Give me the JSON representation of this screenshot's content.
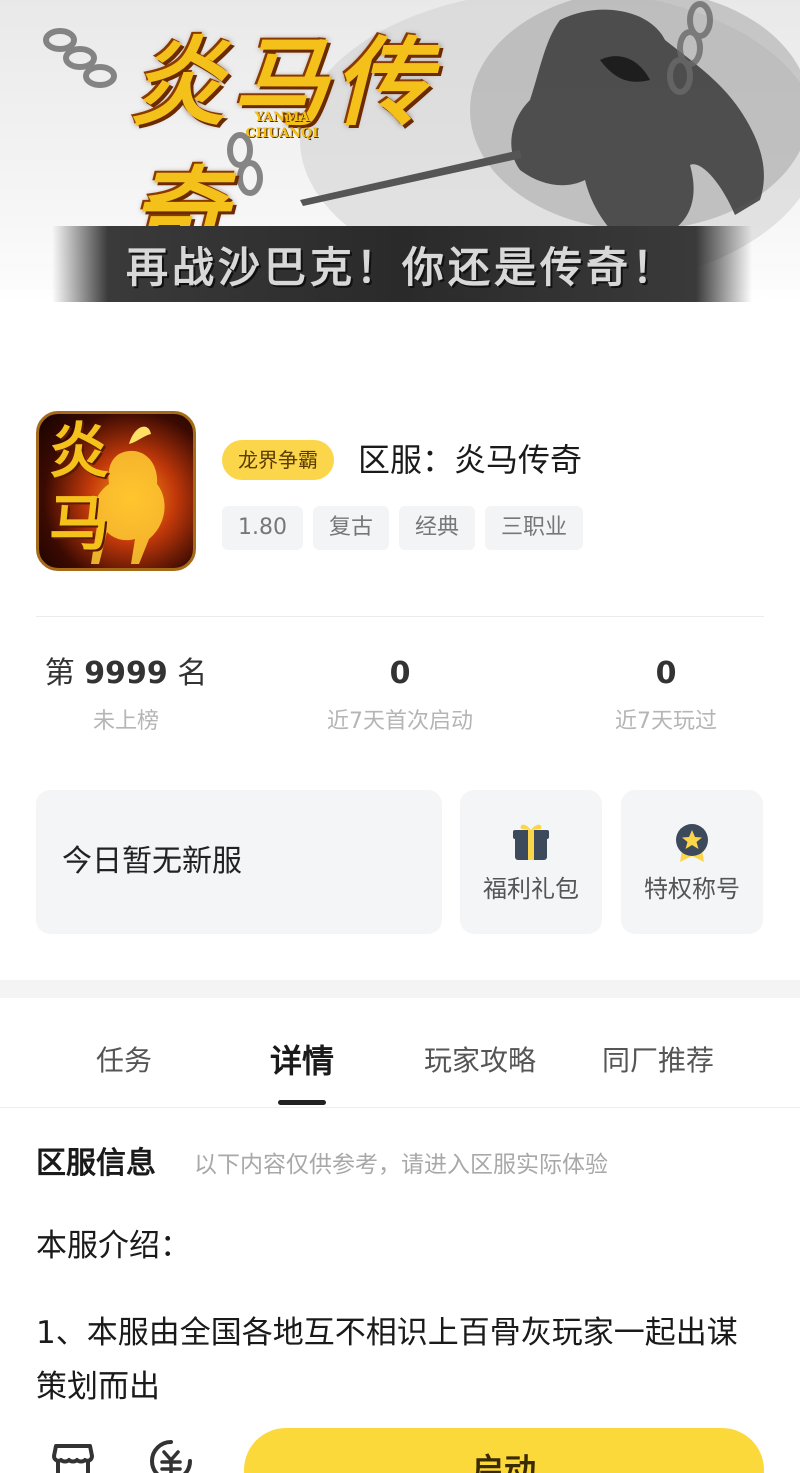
{
  "banner": {
    "logo_cn": "炎马传奇",
    "logo_en_line1": "YANMA",
    "logo_en_line2": "CHUANQI",
    "slogan": "再战沙巴克！你还是传奇！"
  },
  "game": {
    "icon_text": "炎马",
    "tag": "龙界争霸",
    "title": "区服：炎马传奇",
    "chips": [
      "1.80",
      "复古",
      "经典",
      "三职业"
    ]
  },
  "stats": {
    "rank_prefix": "第 ",
    "rank_value": "9999",
    "rank_suffix": " 名",
    "rank_label": "未上榜",
    "first_launch_value": "0",
    "first_launch_label": "近7天首次启动",
    "played_value": "0",
    "played_label": "近7天玩过"
  },
  "cards": {
    "new_server": "今日暂无新服",
    "gift_label": "福利礼包",
    "title_label": "特权称号"
  },
  "tabs": [
    {
      "label": "任务",
      "active": false
    },
    {
      "label": "详情",
      "active": true
    },
    {
      "label": "玩家攻略",
      "active": false
    },
    {
      "label": "同厂推荐",
      "active": false
    }
  ],
  "content": {
    "heading": "区服信息",
    "note": "以下内容仅供参考，请进入区服实际体验",
    "intro_title": "本服介绍：",
    "intro_body": "1、本服由全国各地互不相识上百骨灰玩家一起出谋策划而出"
  },
  "bottom": {
    "launch_label": "启动"
  },
  "colors": {
    "accent_yellow": "#fcd93a",
    "tag_yellow": "#fcd64a",
    "card_bg": "#f4f5f7"
  }
}
